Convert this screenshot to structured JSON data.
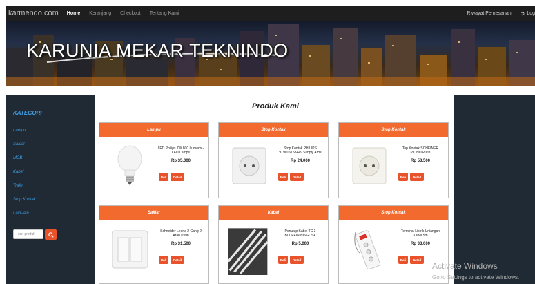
{
  "navbar": {
    "brand": "karmendo.com",
    "items": [
      "Home",
      "Keranjang",
      "Checkout",
      "Tentang Kami"
    ],
    "right_items": [
      "Riwayat Pemesanan",
      "Log"
    ]
  },
  "banner": {
    "title": "KARUNIA MEKAR TEKNINDO"
  },
  "sidebar": {
    "title": "KATEGORI",
    "items": [
      "Lampu",
      "Saklar",
      "MCB",
      "Kabel",
      "Trafo",
      "Stop Kontak",
      "Lain-lain"
    ],
    "search_placeholder": "cari produk"
  },
  "main": {
    "title": "Produk Kami",
    "products": [
      {
        "category": "Lampu",
        "name": "LED Philips 7W 800 Lumens - LED Lamps",
        "price": "Rp 35,000",
        "buy_label": "Beli",
        "detail_label": "Detail",
        "icon": "led-bulb"
      },
      {
        "category": "Stop Kontak",
        "name": "Stop Kontak PHILIPS 919016158449 Simply Ards",
        "price": "Rp 24,000",
        "buy_label": "Beli",
        "detail_label": "Detail",
        "icon": "wall-socket"
      },
      {
        "category": "Stop Kontak",
        "name": "Top Kontak SCHEINER PIONO Putih",
        "price": "Rp 53,500",
        "buy_label": "Beli",
        "detail_label": "Detail",
        "icon": "wall-socket"
      },
      {
        "category": "Saklar",
        "name": "Schneider Leona 2 Gang 2 Arah Putih",
        "price": "Rp 31,500",
        "buy_label": "Beli",
        "detail_label": "Detail",
        "icon": "double-switch"
      },
      {
        "category": "Kabel",
        "name": "Penutup Kabel TC 3 BLUEFIN/NISGUSA",
        "price": "Rp 5,000",
        "buy_label": "Beli",
        "detail_label": "Detail",
        "icon": "cable-duct"
      },
      {
        "category": "Stop Kontak",
        "name": "Terminal Listrik Uniangan Kabel 5m",
        "price": "Rp 33,000",
        "buy_label": "Beli",
        "detail_label": "Detail",
        "icon": "power-strip"
      }
    ]
  },
  "watermark": {
    "line1": "Activate Windows",
    "line2": "Go to Settings to activate Windows."
  },
  "colors": {
    "accent": "#f26a2e",
    "sidebar_bg": "#1f2a34",
    "link": "#3f9fe6"
  }
}
